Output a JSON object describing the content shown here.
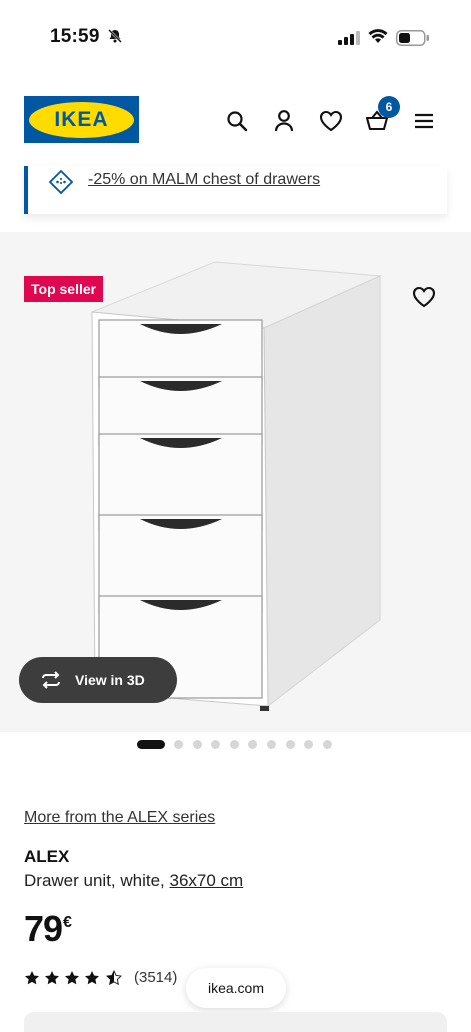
{
  "status_bar": {
    "time": "15:59",
    "icons": [
      "bell-slash-icon",
      "signal-icon",
      "wifi-icon",
      "battery-icon"
    ]
  },
  "header": {
    "logo_text": "IKEA",
    "icons": [
      "search-icon",
      "account-icon",
      "heart-icon",
      "cart-icon",
      "menu-icon"
    ],
    "cart_count": "6",
    "brand_blue": "#0058a3",
    "brand_yellow": "#ffdb00"
  },
  "promo": {
    "text": "-25% on MALM chest of drawers",
    "icon": "offer-tag-icon"
  },
  "gallery": {
    "badge": "Top seller",
    "badge_color": "#e00751",
    "view3d_label": "View in 3D",
    "image_count": 10,
    "active_image": 1
  },
  "product": {
    "series_link": "More from the ALEX series",
    "name": "ALEX",
    "description": "Drawer unit, white, ",
    "dimensions": "36x70 cm",
    "price": "79",
    "currency": "€",
    "rating": 4.5,
    "reviews": "(3514)"
  },
  "browser": {
    "url": "ikea.com"
  }
}
